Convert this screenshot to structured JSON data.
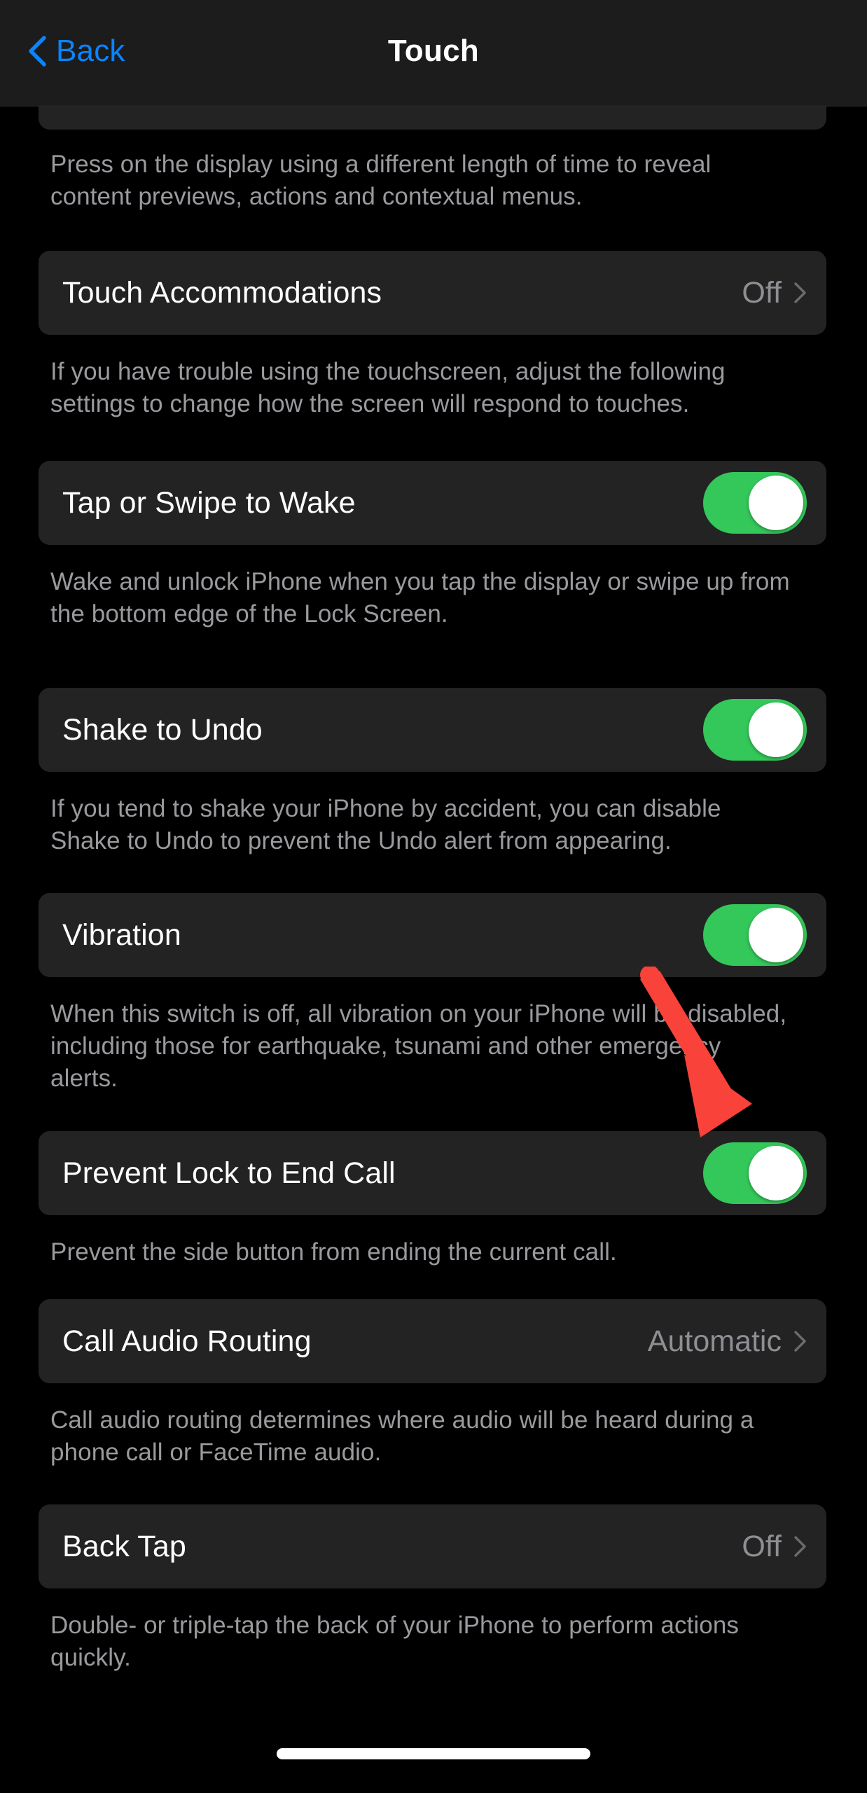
{
  "navbar": {
    "back_label": "Back",
    "title": "Touch",
    "back_icon": "chevron-left-icon",
    "accent_color": "#0a84ff"
  },
  "colors": {
    "page_background": "#000000",
    "card_background": "#232324",
    "navbar_background": "#1c1c1c",
    "toggle_on": "#34c759",
    "primary_text": "#ffffff",
    "secondary_text": "#8e8e93",
    "footer_text": "#9a9a9e",
    "annotation_red": "#f9423a"
  },
  "sections": [
    {
      "id": "haptic-touch",
      "kind": "partial_row_footer",
      "footer": "Press on the display using a different length of time to reveal content previews, actions and contextual menus."
    },
    {
      "id": "touch-accommodations",
      "kind": "disclosure",
      "label": "Touch Accommodations",
      "value": "Off",
      "accessory": "chevron-right-icon",
      "footer": "If you have trouble using the touchscreen, adjust the following settings to change how the screen will respond to touches."
    },
    {
      "id": "tap-or-swipe-to-wake",
      "kind": "toggle",
      "label": "Tap or Swipe to Wake",
      "state": "on",
      "footer": "Wake and unlock iPhone when you tap the display or swipe up from the bottom edge of the Lock Screen."
    },
    {
      "id": "shake-to-undo",
      "kind": "toggle",
      "label": "Shake to Undo",
      "state": "on",
      "footer": "If you tend to shake your iPhone by accident, you can disable Shake to Undo to prevent the Undo alert from appearing."
    },
    {
      "id": "vibration",
      "kind": "toggle",
      "label": "Vibration",
      "state": "on",
      "footer": "When this switch is off, all vibration on your iPhone will be disabled, including those for earthquake, tsunami and other emergency alerts."
    },
    {
      "id": "prevent-lock-to-end-call",
      "kind": "toggle",
      "label": "Prevent Lock to End Call",
      "state": "on",
      "footer": "Prevent the side button from ending the current call."
    },
    {
      "id": "call-audio-routing",
      "kind": "disclosure",
      "label": "Call Audio Routing",
      "value": "Automatic",
      "accessory": "chevron-right-icon",
      "footer": "Call audio routing determines where audio will be heard during a phone call or FaceTime audio."
    },
    {
      "id": "back-tap",
      "kind": "disclosure",
      "label": "Back Tap",
      "value": "Off",
      "accessory": "chevron-right-icon",
      "footer": "Double- or triple-tap the back of your iPhone to perform actions quickly."
    }
  ],
  "annotation": {
    "type": "arrow",
    "points_to": "prevent-lock-to-end-call-toggle",
    "color": "#f9423a"
  }
}
